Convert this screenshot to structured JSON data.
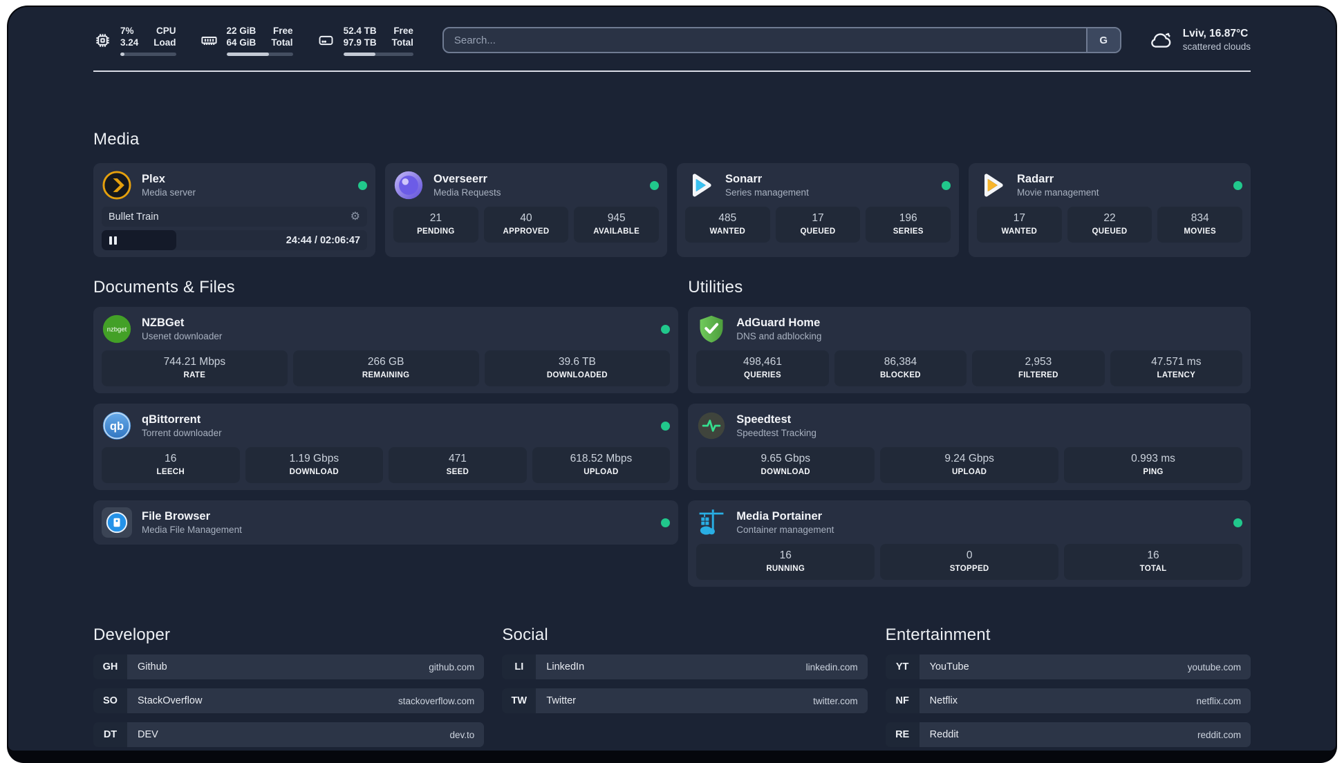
{
  "colors": {
    "status_green": "#21c88c",
    "plex_orange": "#e5a00d",
    "sonarr_blue": "#38c1f1",
    "radarr_yellow": "#f7b52c",
    "adguard_green": "#67c353",
    "portainer_blue": "#29aee4",
    "speedtest_pulse": "#35e08f"
  },
  "topbar": {
    "stats": [
      {
        "icon": "cpu-icon",
        "v1": "7%",
        "v2": "3.24",
        "l1": "CPU",
        "l2": "Load",
        "progress": 7
      },
      {
        "icon": "ram-icon",
        "v1": "22 GiB",
        "v2": "64 GiB",
        "l1": "Free",
        "l2": "Total",
        "progress": 64
      },
      {
        "icon": "disk-icon",
        "v1": "52.4 TB",
        "v2": "97.9 TB",
        "l1": "Free",
        "l2": "Total",
        "progress": 46
      }
    ],
    "search": {
      "placeholder": "Search...",
      "button": "G"
    },
    "weather": {
      "location_temp": "Lviv, 16.87°C",
      "condition": "scattered clouds"
    }
  },
  "media": {
    "title": "Media",
    "plex": {
      "name": "Plex",
      "desc": "Media server",
      "now_playing": "Bullet Train",
      "time": "24:44 / 02:06:47",
      "progress_pct": 28
    },
    "overseerr": {
      "name": "Overseerr",
      "desc": "Media Requests",
      "stats": [
        {
          "value": "21",
          "label": "PENDING"
        },
        {
          "value": "40",
          "label": "APPROVED"
        },
        {
          "value": "945",
          "label": "AVAILABLE"
        }
      ]
    },
    "sonarr": {
      "name": "Sonarr",
      "desc": "Series management",
      "stats": [
        {
          "value": "485",
          "label": "WANTED"
        },
        {
          "value": "17",
          "label": "QUEUED"
        },
        {
          "value": "196",
          "label": "SERIES"
        }
      ]
    },
    "radarr": {
      "name": "Radarr",
      "desc": "Movie management",
      "stats": [
        {
          "value": "17",
          "label": "WANTED"
        },
        {
          "value": "22",
          "label": "QUEUED"
        },
        {
          "value": "834",
          "label": "MOVIES"
        }
      ]
    }
  },
  "docs": {
    "title": "Documents & Files",
    "nzbget": {
      "name": "NZBGet",
      "desc": "Usenet downloader",
      "stats": [
        {
          "value": "744.21 Mbps",
          "label": "RATE"
        },
        {
          "value": "266 GB",
          "label": "REMAINING"
        },
        {
          "value": "39.6 TB",
          "label": "DOWNLOADED"
        }
      ]
    },
    "qbittorrent": {
      "name": "qBittorrent",
      "desc": "Torrent downloader",
      "stats": [
        {
          "value": "16",
          "label": "LEECH"
        },
        {
          "value": "1.19 Gbps",
          "label": "DOWNLOAD"
        },
        {
          "value": "471",
          "label": "SEED"
        },
        {
          "value": "618.52 Mbps",
          "label": "UPLOAD"
        }
      ]
    },
    "filebrowser": {
      "name": "File Browser",
      "desc": "Media File Management"
    }
  },
  "utilities": {
    "title": "Utilities",
    "adguard": {
      "name": "AdGuard Home",
      "desc": "DNS and adblocking",
      "stats": [
        {
          "value": "498,461",
          "label": "QUERIES"
        },
        {
          "value": "86,384",
          "label": "BLOCKED"
        },
        {
          "value": "2,953",
          "label": "FILTERED"
        },
        {
          "value": "47.571 ms",
          "label": "LATENCY"
        }
      ]
    },
    "speedtest": {
      "name": "Speedtest",
      "desc": "Speedtest Tracking",
      "stats": [
        {
          "value": "9.65 Gbps",
          "label": "DOWNLOAD"
        },
        {
          "value": "9.24 Gbps",
          "label": "UPLOAD"
        },
        {
          "value": "0.993 ms",
          "label": "PING"
        }
      ]
    },
    "portainer": {
      "name": "Media Portainer",
      "desc": "Container management",
      "stats": [
        {
          "value": "16",
          "label": "RUNNING"
        },
        {
          "value": "0",
          "label": "STOPPED"
        },
        {
          "value": "16",
          "label": "TOTAL"
        }
      ]
    }
  },
  "bookmarks": {
    "developer": {
      "title": "Developer",
      "items": [
        {
          "code": "GH",
          "name": "Github",
          "url": "github.com"
        },
        {
          "code": "SO",
          "name": "StackOverflow",
          "url": "stackoverflow.com"
        },
        {
          "code": "DT",
          "name": "DEV",
          "url": "dev.to"
        }
      ]
    },
    "social": {
      "title": "Social",
      "items": [
        {
          "code": "LI",
          "name": "LinkedIn",
          "url": "linkedin.com"
        },
        {
          "code": "TW",
          "name": "Twitter",
          "url": "twitter.com"
        }
      ]
    },
    "entertainment": {
      "title": "Entertainment",
      "items": [
        {
          "code": "YT",
          "name": "YouTube",
          "url": "youtube.com"
        },
        {
          "code": "NF",
          "name": "Netflix",
          "url": "netflix.com"
        },
        {
          "code": "RE",
          "name": "Reddit",
          "url": "reddit.com"
        }
      ]
    }
  }
}
